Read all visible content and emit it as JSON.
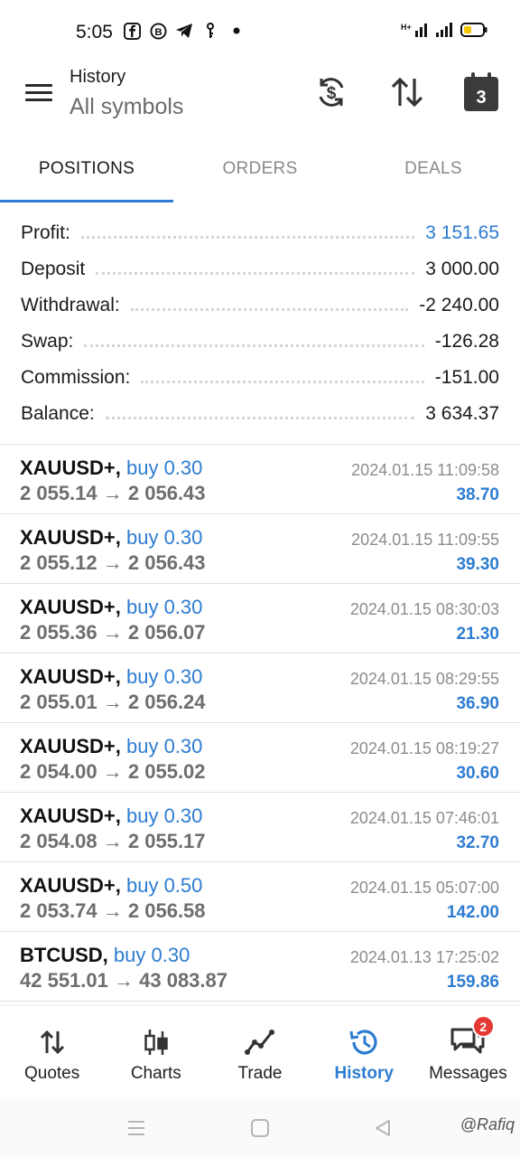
{
  "status_bar": {
    "time": "5:05",
    "notification_icons": [
      "facebook-icon",
      "b-icon",
      "telegram-icon",
      "key-icon",
      "dot-icon"
    ],
    "right_icons": [
      "network-icon",
      "signal-icon",
      "battery-icon"
    ],
    "battery_color": "#f5c400"
  },
  "app_bar": {
    "subtitle": "History",
    "title": "All symbols",
    "calendar_day": "3"
  },
  "tabs": [
    {
      "label": "POSITIONS",
      "active": true
    },
    {
      "label": "ORDERS",
      "active": false
    },
    {
      "label": "DEALS",
      "active": false
    }
  ],
  "summary": [
    {
      "label": "Profit:",
      "value": "3 151.65",
      "highlight": true
    },
    {
      "label": "Deposit",
      "value": "3 000.00",
      "highlight": false
    },
    {
      "label": "Withdrawal:",
      "value": "-2 240.00",
      "highlight": false
    },
    {
      "label": "Swap:",
      "value": "-126.28",
      "highlight": false
    },
    {
      "label": "Commission:",
      "value": "-151.00",
      "highlight": false
    },
    {
      "label": "Balance:",
      "value": "3 634.37",
      "highlight": false
    }
  ],
  "deals": [
    {
      "symbol": "XAUUSD+,",
      "side": "buy 0.30",
      "open": "2 055.14",
      "arrow": "→",
      "close": "2 056.43",
      "time": "2024.01.15 11:09:58",
      "profit": "38.70"
    },
    {
      "symbol": "XAUUSD+,",
      "side": "buy 0.30",
      "open": "2 055.12",
      "arrow": "→",
      "close": "2 056.43",
      "time": "2024.01.15 11:09:55",
      "profit": "39.30"
    },
    {
      "symbol": "XAUUSD+,",
      "side": "buy 0.30",
      "open": "2 055.36",
      "arrow": "→",
      "close": "2 056.07",
      "time": "2024.01.15 08:30:03",
      "profit": "21.30"
    },
    {
      "symbol": "XAUUSD+,",
      "side": "buy 0.30",
      "open": "2 055.01",
      "arrow": "→",
      "close": "2 056.24",
      "time": "2024.01.15 08:29:55",
      "profit": "36.90"
    },
    {
      "symbol": "XAUUSD+,",
      "side": "buy 0.30",
      "open": "2 054.00",
      "arrow": "→",
      "close": "2 055.02",
      "time": "2024.01.15 08:19:27",
      "profit": "30.60"
    },
    {
      "symbol": "XAUUSD+,",
      "side": "buy 0.30",
      "open": "2 054.08",
      "arrow": "→",
      "close": "2 055.17",
      "time": "2024.01.15 07:46:01",
      "profit": "32.70"
    },
    {
      "symbol": "XAUUSD+,",
      "side": "buy 0.50",
      "open": "2 053.74",
      "arrow": "→",
      "close": "2 056.58",
      "time": "2024.01.15 05:07:00",
      "profit": "142.00"
    },
    {
      "symbol": "BTCUSD,",
      "side": "buy 0.30",
      "open": "42 551.01",
      "arrow": "→",
      "close": "43 083.87",
      "time": "2024.01.13 17:25:02",
      "profit": "159.86"
    }
  ],
  "bottom_nav": [
    {
      "label": "Quotes",
      "icon": "quotes-arrows-icon",
      "active": false
    },
    {
      "label": "Charts",
      "icon": "candlestick-icon",
      "active": false
    },
    {
      "label": "Trade",
      "icon": "trade-line-icon",
      "active": false
    },
    {
      "label": "History",
      "icon": "history-clock-icon",
      "active": true
    },
    {
      "label": "Messages",
      "icon": "chat-bubbles-icon",
      "active": false,
      "badge": "2"
    }
  ],
  "watermark": "@Rafiq",
  "colors": {
    "accent": "#2d7cd1",
    "badge": "#e53935"
  }
}
